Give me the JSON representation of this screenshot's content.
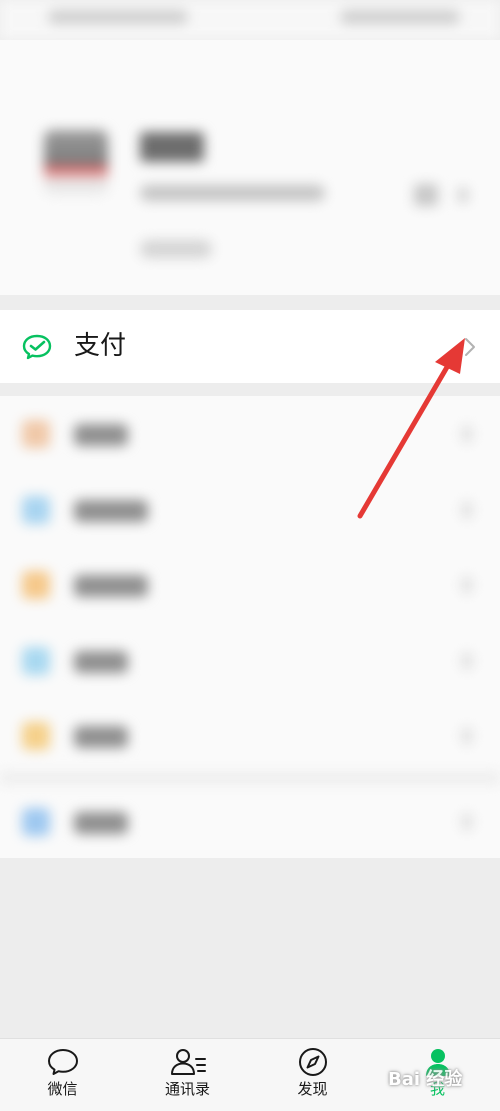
{
  "pay_row": {
    "label": "支付",
    "icon": "wechat-pay-icon",
    "accent": "#07c160"
  },
  "tab_bar": {
    "tabs": [
      {
        "label": "微信",
        "icon": "chat-bubble-icon",
        "active": false
      },
      {
        "label": "通讯录",
        "icon": "contacts-icon",
        "active": false
      },
      {
        "label": "发现",
        "icon": "compass-icon",
        "active": false
      },
      {
        "label": "我",
        "icon": "profile-person-icon",
        "active": true
      }
    ],
    "active_color": "#07c160"
  },
  "annotation": {
    "arrow_color": "#e53935"
  },
  "watermark": {
    "text": "Bai 经验"
  }
}
